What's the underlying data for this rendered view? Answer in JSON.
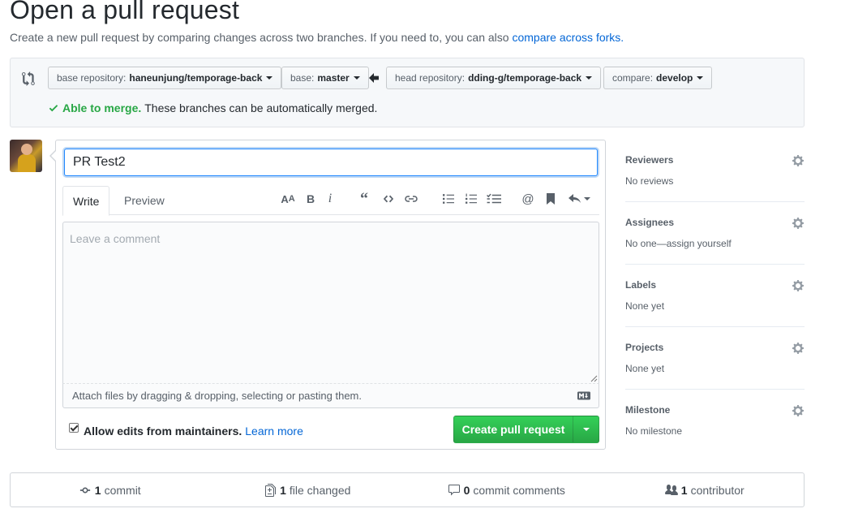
{
  "header": {
    "title": "Open a pull request",
    "subtitle": "Create a new pull request by comparing changes across two branches. If you need to, you can also",
    "subtitle_link": "compare across forks."
  },
  "compare": {
    "base_repo_label": "base repository:",
    "base_repo_value": "haneunjung/temporage-back",
    "base_label": "base:",
    "base_value": "master",
    "head_repo_label": "head repository:",
    "head_repo_value": "dding-g/temporage-back",
    "compare_label": "compare:",
    "compare_value": "develop",
    "merge_ok": "Able to merge.",
    "merge_text": "These branches can be automatically merged."
  },
  "form": {
    "title_value": "PR Test2",
    "tabs": [
      "Write",
      "Preview"
    ],
    "comment_placeholder": "Leave a comment",
    "attach_text": "Attach files by dragging & dropping, selecting or pasting them.",
    "allow_edits_label": "Allow edits from maintainers.",
    "learn_more": "Learn more",
    "create_button": "Create pull request"
  },
  "sidebar": [
    {
      "title": "Reviewers",
      "value": "No reviews"
    },
    {
      "title": "Assignees",
      "value": "No one—assign yourself"
    },
    {
      "title": "Labels",
      "value": "None yet"
    },
    {
      "title": "Projects",
      "value": "None yet"
    },
    {
      "title": "Milestone",
      "value": "No milestone"
    }
  ],
  "stats": {
    "commits_num": "1",
    "commits_label": "commit",
    "files_num": "1",
    "files_label": "file changed",
    "comments_num": "0",
    "comments_label": "commit comments",
    "contributors_num": "1",
    "contributors_label": "contributor"
  },
  "colors": {
    "accent": "#0366d6",
    "success": "#28a745",
    "muted": "#586069"
  }
}
